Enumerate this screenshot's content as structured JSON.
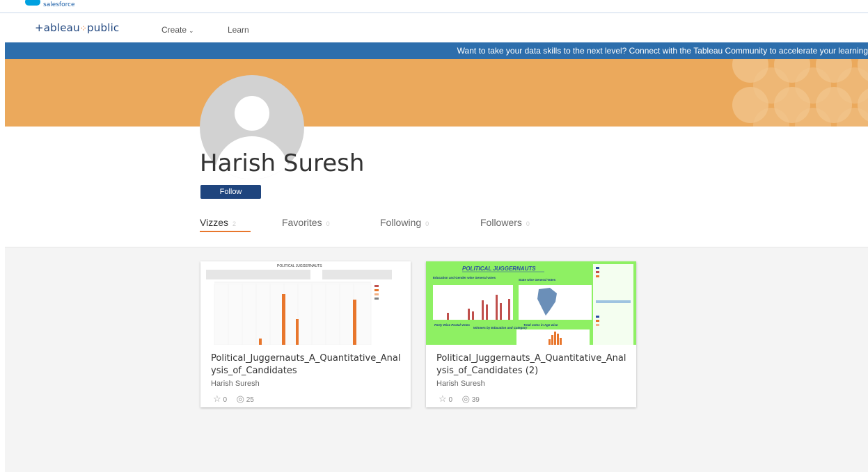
{
  "salesforce_bar": {
    "logo_text": "salesforce"
  },
  "nav": {
    "logo_text": "+ableau",
    "logo_spark": "⁘",
    "logo_text2": "public",
    "create_label": "Create",
    "learn_label": "Learn"
  },
  "announcement": "Want to take your data skills to the next level? Connect with the Tableau Community to accelerate your learning",
  "profile": {
    "name": "Harish Suresh",
    "follow_label": "Follow"
  },
  "tabs": [
    {
      "label": "Vizzes",
      "count": "2"
    },
    {
      "label": "Favorites",
      "count": "0"
    },
    {
      "label": "Following",
      "count": "0"
    },
    {
      "label": "Followers",
      "count": "0"
    }
  ],
  "vizzes": [
    {
      "title": "Political_Juggernauts_A_Quantitative_Analysis_of_Candidates",
      "author": "Harish Suresh",
      "favorites": "0",
      "views": "25",
      "thumb_heading": "POLITICAL JUGGERNAUTS"
    },
    {
      "title": "Political_Juggernauts_A_Quantitative_Analysis_of_Candidates (2)",
      "author": "Harish Suresh",
      "favorites": "0",
      "views": "39",
      "thumb_heading": "POLITICAL JUGGERNAUTS",
      "thumb_labels": [
        "Education and Gender wise General votes",
        "State wise General Votes",
        "Party Wise Postal Votes",
        "Winners by Education and Category",
        "Total votes in Age wise"
      ]
    }
  ],
  "colors": {
    "brand_navy": "#1f457e",
    "accent_orange": "#e8762c",
    "banner_orange": "#eba95c",
    "announce_blue": "#2d6eac",
    "thumb_green": "#8ef063"
  },
  "icons": {
    "star": "star-icon",
    "views": "eye-icon",
    "chevron": "chevron-down-icon"
  }
}
